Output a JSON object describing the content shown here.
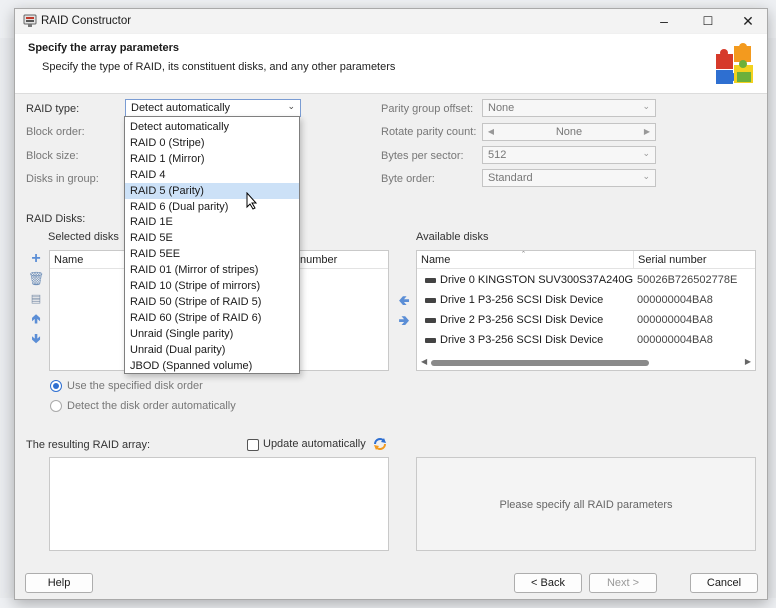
{
  "window": {
    "title": "RAID Constructor"
  },
  "header": {
    "heading": "Specify the array parameters",
    "subheading": "Specify the type of RAID, its constituent disks, and any other parameters"
  },
  "params": {
    "raid_type_label": "RAID type:",
    "raid_type_value": "Detect automatically",
    "block_order_label": "Block order:",
    "block_size_label": "Block size:",
    "disks_in_group_label": "Disks in group:",
    "parity_offset_label": "Parity group offset:",
    "parity_offset_value": "None",
    "rotate_parity_label": "Rotate parity count:",
    "rotate_parity_value": "None",
    "bytes_per_sector_label": "Bytes per sector:",
    "bytes_per_sector_value": "512",
    "byte_order_label": "Byte order:",
    "byte_order_value": "Standard"
  },
  "raid_dropdown": {
    "items": [
      "Detect automatically",
      "RAID 0 (Stripe)",
      "RAID 1 (Mirror)",
      "RAID 4",
      "RAID 5 (Parity)",
      "RAID 6 (Dual parity)",
      "RAID 1E",
      "RAID 5E",
      "RAID 5EE",
      "RAID 01 (Mirror of stripes)",
      "RAID 10 (Stripe of mirrors)",
      "RAID 50 (Stripe of RAID 5)",
      "RAID 60 (Stripe of RAID 6)",
      "Unraid (Single parity)",
      "Unraid (Dual parity)",
      "JBOD (Spanned volume)"
    ],
    "highlighted": "RAID 5 (Parity)"
  },
  "disks": {
    "section_label": "RAID Disks:",
    "selected_label": "Selected disks",
    "selected_columns": [
      "Name",
      "number"
    ],
    "available_label": "Available disks",
    "available_columns": [
      "Name",
      "Serial number"
    ],
    "available": [
      {
        "name": "Drive 0 KINGSTON SUV300S37A240G",
        "serial": "50026B726502778E"
      },
      {
        "name": "Drive 1 P3-256  SCSI Disk Device",
        "serial": "000000004BA8"
      },
      {
        "name": "Drive 2 P3-256  SCSI Disk Device",
        "serial": "000000004BA8"
      },
      {
        "name": "Drive 3 P3-256  SCSI Disk Device",
        "serial": "000000004BA8"
      }
    ]
  },
  "order": {
    "use_specified": "Use the specified disk order",
    "detect_auto": "Detect the disk order automatically"
  },
  "result": {
    "label": "The resulting RAID array:",
    "update_auto": "Update automatically",
    "placeholder": "Please specify all RAID parameters"
  },
  "buttons": {
    "help": "Help",
    "back": "< Back",
    "next": "Next >",
    "cancel": "Cancel"
  },
  "colors": {
    "accent": "#2f6fd1",
    "highlight": "#cce1f7",
    "icon_blue": "#5b8ed6"
  }
}
